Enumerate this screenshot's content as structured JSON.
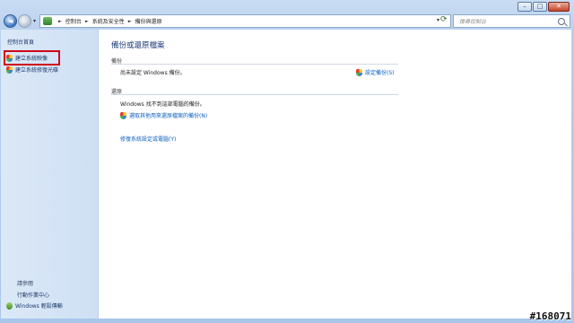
{
  "window": {
    "controls": {
      "minimize": "–",
      "maximize": "□",
      "close": "✕"
    }
  },
  "nav": {
    "back": "◄",
    "forward": "►",
    "dropdown": "▾",
    "breadcrumb": [
      "控制台",
      "系統及安全性",
      "備份與還原"
    ],
    "separator": "►",
    "address_dropdown": "▾",
    "refresh": "⟳",
    "search_placeholder": "搜尋控制台"
  },
  "sidebar": {
    "home": "控制台首頁",
    "items": [
      {
        "label": "建立系統映像",
        "icon": "shield-icon",
        "highlighted": true
      },
      {
        "label": "建立系統修復光碟",
        "icon": "shield-icon",
        "highlighted": false
      }
    ],
    "see_also": "請參閱",
    "bottom_items": [
      {
        "label": "行動作業中心"
      },
      {
        "label": "Windows 輕鬆傳輸"
      }
    ]
  },
  "main": {
    "title": "備份或還原檔案",
    "backup": {
      "heading": "備份",
      "status": "尚未設定 Windows 備份。",
      "setup_link": "設定備份(S)"
    },
    "restore": {
      "heading": "還原",
      "status": "Windows 找不到這部電腦的備份。",
      "select_link": "選取其他用來還原檔案的備份(N)",
      "recover_link": "修復系統設定或電腦(Y)"
    }
  },
  "watermark": "#168071"
}
